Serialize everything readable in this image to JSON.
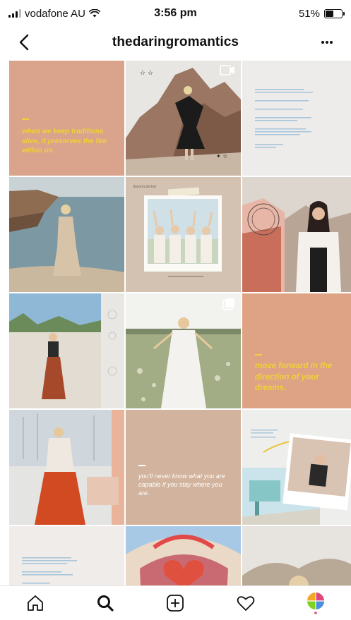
{
  "status_bar": {
    "carrier": "vodafone AU",
    "time": "3:56 pm",
    "battery": "51%",
    "battery_level": 0.51
  },
  "header": {
    "title": "thedaringromantics"
  },
  "posts": [
    {
      "kind": "quote",
      "bg": "#d9a48b",
      "text": "when we keep traditions alive, it preserves the fire within us.",
      "text_color": "#f0d13b"
    },
    {
      "kind": "photo",
      "scene": "desert-rocks",
      "overlay": "video-icon"
    },
    {
      "kind": "text-card",
      "bg": "#eeecea"
    },
    {
      "kind": "photo",
      "scene": "ocean-cliff"
    },
    {
      "kind": "photo",
      "scene": "polaroid-friends",
      "overlay_text": "it's call him home",
      "caption_text": "dreamcatcher"
    },
    {
      "kind": "photo",
      "scene": "desert-portrait"
    },
    {
      "kind": "photo",
      "scene": "beach-swing"
    },
    {
      "kind": "photo",
      "scene": "field-lace",
      "overlay": "carousel-icon"
    },
    {
      "kind": "quote",
      "bg": "#dea284",
      "text": "move forward in the direction of your dreams.",
      "text_color": "#f0d13b"
    },
    {
      "kind": "photo",
      "scene": "harbor-skirt"
    },
    {
      "kind": "quote",
      "bg": "#d2b39d",
      "text": "you'll never know what you are capable if you stay where you are.",
      "text_color": "#ffffff"
    },
    {
      "kind": "photo",
      "scene": "lifeguard-polaroid"
    },
    {
      "kind": "text-card",
      "bg": "#efece9"
    },
    {
      "kind": "photo",
      "scene": "salvation-mountain"
    },
    {
      "kind": "photo",
      "scene": "desert-hills"
    }
  ],
  "tabs": [
    {
      "name": "home",
      "icon": "home-icon"
    },
    {
      "name": "search",
      "icon": "search-icon"
    },
    {
      "name": "new-post",
      "icon": "plus-square-icon"
    },
    {
      "name": "activity",
      "icon": "heart-icon"
    },
    {
      "name": "profile",
      "icon": "profile-avatar-icon"
    }
  ],
  "colors": {
    "quote_yellow": "#f0d13b",
    "peach": "#d9a48b",
    "tan": "#d2b39d"
  }
}
